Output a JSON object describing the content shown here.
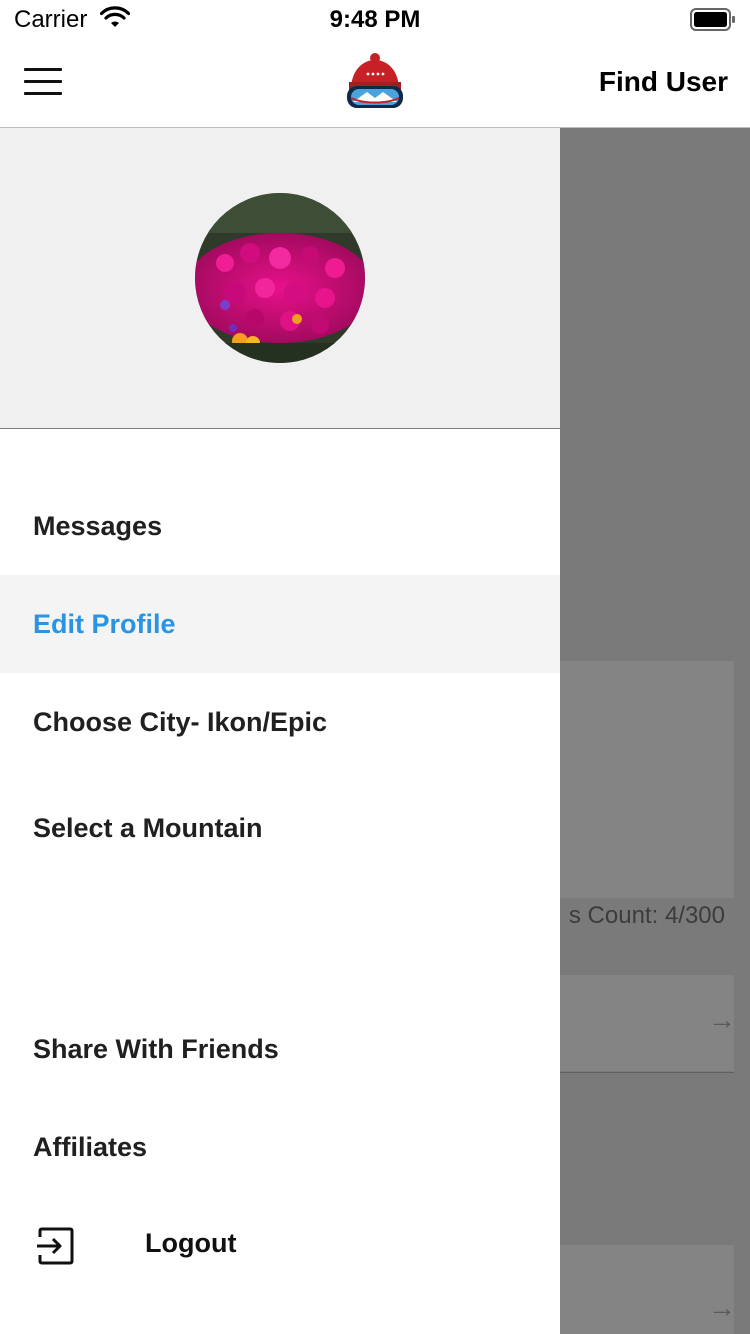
{
  "status_bar": {
    "carrier": "Carrier",
    "time": "9:48 PM"
  },
  "navbar": {
    "find_user_label": "Find User",
    "menu_icon": "hamburger-menu-icon",
    "logo_icon": "beanie-goggles-logo"
  },
  "drawer": {
    "menu": {
      "messages": "Messages",
      "edit_profile": "Edit Profile",
      "choose_city": "Choose City- Ikon/Epic",
      "select_mountain": "Select a Mountain",
      "share": "Share With Friends",
      "affiliates": "Affiliates",
      "logout": "Logout"
    },
    "active_item": "Edit Profile",
    "accent_color": "#2a94e3"
  },
  "background_screen": {
    "count_text": "s Count: 4/300"
  }
}
